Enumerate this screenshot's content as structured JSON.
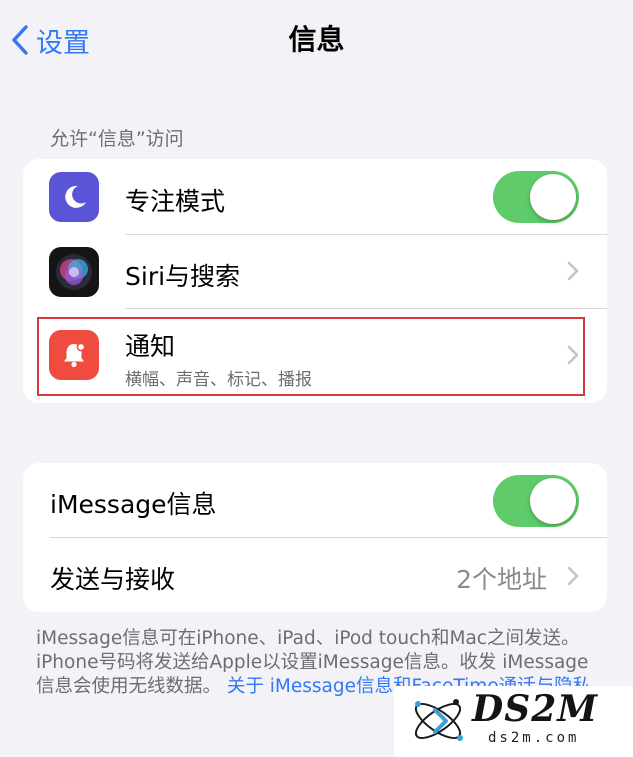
{
  "nav": {
    "back_label": "设置",
    "title": "信息"
  },
  "section1": {
    "header": "允许“信息”访问",
    "focus": {
      "label": "专注模式",
      "toggle": true
    },
    "siri": {
      "label": "Siri与搜索"
    },
    "notifications": {
      "label": "通知",
      "subtitle": "横幅、声音、标记、播报"
    }
  },
  "section2": {
    "imessage": {
      "label": "iMessage信息",
      "toggle": true
    },
    "send_receive": {
      "label": "发送与接收",
      "value": "2个地址"
    }
  },
  "footer": {
    "text": "iMessage信息可在iPhone、iPad、iPod touch和Mac之间发送。iPhone号码将发送给Apple以设置iMessage信息。收发 iMessage信息会使用无线数据。 ",
    "link": "关于 iMessage信息和FaceTime通话与隐私"
  },
  "watermark": {
    "brand": "DS2M",
    "site": "ds2m.com"
  },
  "colors": {
    "accent": "#3478f6",
    "toggle_on": "#5fcb6a",
    "focus_icon": "#5b54d6",
    "notification_icon": "#ef4b3f",
    "highlight": "#d8383a",
    "background": "#f2f2f7"
  }
}
